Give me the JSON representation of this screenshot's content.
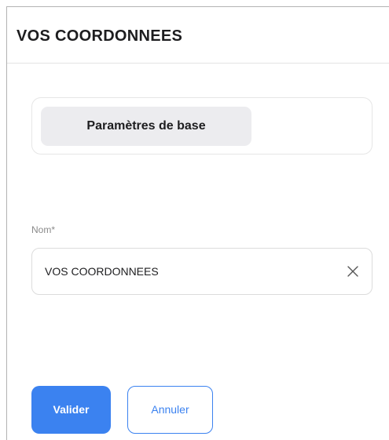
{
  "panel": {
    "title": "VOS COORDONNEES"
  },
  "tabs": [
    {
      "label": "Paramètres de base",
      "active": true
    }
  ],
  "form": {
    "name_field": {
      "label": "Nom*",
      "value": "VOS COORDONNEES",
      "clear_icon": "close-icon"
    }
  },
  "actions": {
    "submit_label": "Valider",
    "cancel_label": "Annuler"
  },
  "colors": {
    "accent": "#3b82f0",
    "tab_background": "#ececef",
    "title_text": "#1d1d1f",
    "label_text": "#8a8a8a"
  }
}
